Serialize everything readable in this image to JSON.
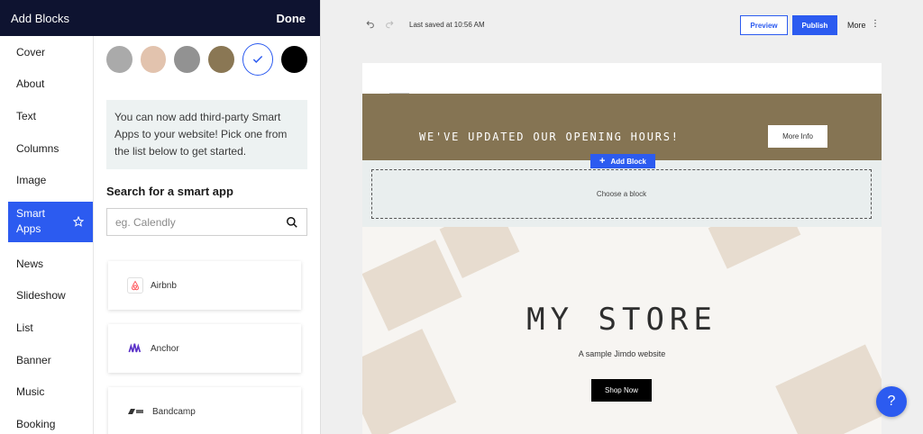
{
  "panel": {
    "title": "Add Blocks",
    "done_label": "Done"
  },
  "categories": [
    "Cover",
    "About",
    "Text",
    "Columns",
    "Image",
    "Smart Apps",
    "News",
    "Slideshow",
    "List",
    "Banner",
    "Music",
    "Booking"
  ],
  "active_category": "Smart Apps",
  "swatches": [
    "#aaaaaa",
    "#e2c3ae",
    "#929292",
    "#8a7754",
    "#ffffff",
    "#000000"
  ],
  "info_text": "You can now add third-party Smart Apps to your website! Pick one from the list below to get started.",
  "search": {
    "heading": "Search for a smart app",
    "placeholder": "eg. Calendly"
  },
  "apps": [
    {
      "name": "Airbnb",
      "icon": "airbnb-icon"
    },
    {
      "name": "Anchor",
      "icon": "anchor-icon"
    },
    {
      "name": "Bandcamp",
      "icon": "bandcamp-icon"
    }
  ],
  "toolbar": {
    "last_saved": "Last saved at 10:56 AM",
    "preview_label": "Preview",
    "publish_label": "Publish",
    "more_label": "More"
  },
  "site": {
    "banner_text": "WE'VE UPDATED OUR OPENING HOURS!",
    "more_info_label": "More Info",
    "add_block_label": "Add Block",
    "choose_block_label": "Choose a block",
    "store_title": "MY STORE",
    "store_subtitle": "A sample Jimdo website",
    "shop_now_label": "Shop Now"
  },
  "help_label": "?",
  "colors": {
    "accent": "#2c5bf0",
    "header": "#0e1330",
    "banner": "#857453"
  }
}
